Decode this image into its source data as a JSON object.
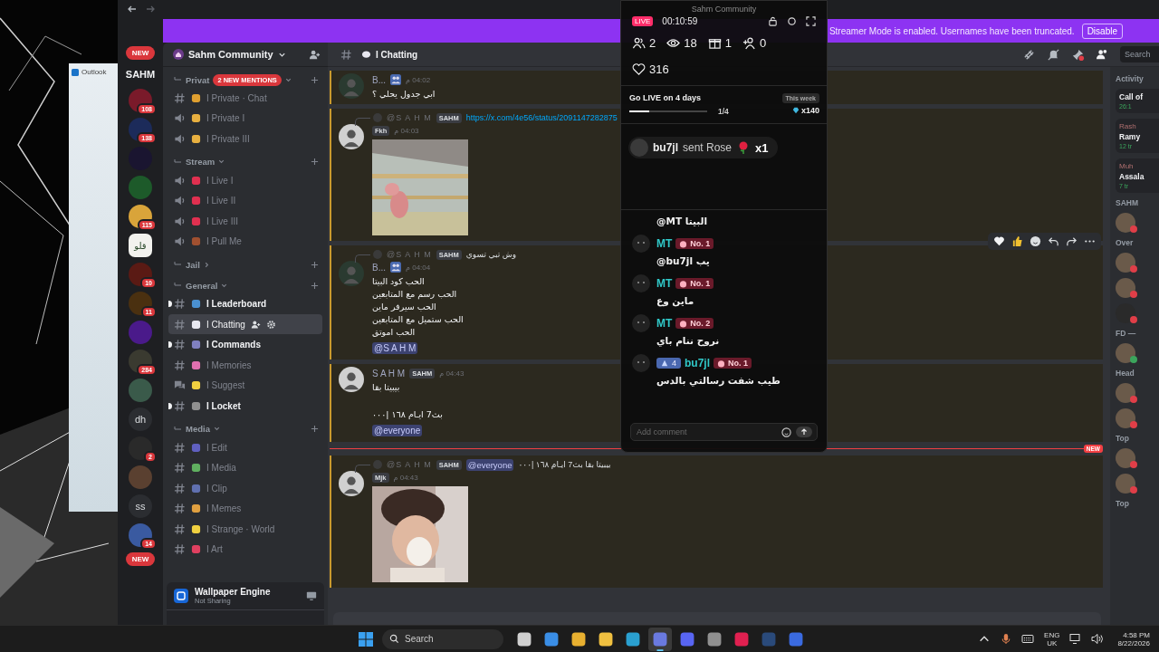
{
  "desktop": {
    "window": {
      "title": "Outlook"
    }
  },
  "discord": {
    "banner": {
      "text": "Streamer Mode is enabled. Usernames have been truncated.",
      "button": "Disable"
    },
    "servers": [
      {
        "kind": "new",
        "label": "NEW"
      },
      {
        "kind": "name",
        "label": "SAHM"
      },
      {
        "kind": "icon",
        "color": "#7a1a2a",
        "badge": "108"
      },
      {
        "kind": "icon",
        "color": "#1c2b5a",
        "badge": "138"
      },
      {
        "kind": "icon",
        "color": "#1a1530"
      },
      {
        "kind": "icon",
        "color": "#1d5a2a"
      },
      {
        "kind": "icon",
        "color": "#d9a43a",
        "badge": "115"
      },
      {
        "kind": "light",
        "label": "قلو"
      },
      {
        "kind": "icon",
        "color": "#5a1a14",
        "badge": "10"
      },
      {
        "kind": "icon",
        "color": "#4a3010",
        "badge": "11"
      },
      {
        "kind": "icon",
        "color": "#4a1a8a"
      },
      {
        "kind": "icon",
        "color": "#3a3a30",
        "badge": "284"
      },
      {
        "kind": "icon",
        "color": "#3a5a4a"
      },
      {
        "kind": "text",
        "label": "dh"
      },
      {
        "kind": "icon",
        "color": "#2a2a2a",
        "badge": "2"
      },
      {
        "kind": "icon",
        "color": "#5a4030"
      },
      {
        "kind": "text",
        "label": "ss"
      },
      {
        "kind": "icon",
        "color": "#3a5aa0",
        "badge": "14"
      },
      {
        "kind": "new",
        "label": "NEW"
      }
    ],
    "server_name": "Sahm Community",
    "categories": [
      {
        "name": "Privat",
        "expanded": true,
        "badge": "2 NEW MENTIONS",
        "channels": [
          {
            "kind": "text",
            "name": "I Private · Chat",
            "color": "#e0a030",
            "unread": false,
            "selected": false
          },
          {
            "kind": "voice",
            "name": "I Private I",
            "color": "#e8b040",
            "unread": false,
            "selected": false
          },
          {
            "kind": "voice",
            "name": "I Private III",
            "color": "#e8b040",
            "unread": false,
            "selected": false
          }
        ]
      },
      {
        "name": "Stream",
        "expanded": true,
        "channels": [
          {
            "kind": "voice",
            "name": "I Live I",
            "color": "#e03050",
            "unread": false,
            "selected": false
          },
          {
            "kind": "voice",
            "name": "I Live II",
            "color": "#e03050",
            "unread": false,
            "selected": false
          },
          {
            "kind": "voice",
            "name": "I Live III",
            "color": "#e03050",
            "unread": false,
            "selected": false
          },
          {
            "kind": "voice",
            "name": "I Pull Me",
            "color": "#a05030",
            "unread": false,
            "selected": false
          }
        ]
      },
      {
        "name": "Jail",
        "expanded": false
      },
      {
        "name": "General",
        "expanded": true,
        "channels": [
          {
            "kind": "text",
            "name": "I Leaderboard",
            "color": "#4a90d0",
            "unread": true,
            "selected": false
          },
          {
            "kind": "text",
            "name": "I Chatting",
            "color": "#e8e8f0",
            "unread": false,
            "selected": true
          },
          {
            "kind": "text",
            "name": "I Commands",
            "color": "#8080c0",
            "unread": true,
            "selected": false
          },
          {
            "kind": "text",
            "name": "I Memories",
            "color": "#e070b0",
            "unread": false,
            "selected": false
          },
          {
            "kind": "forum",
            "name": "I Suggest",
            "color": "#f0d040",
            "unread": false,
            "selected": false
          },
          {
            "kind": "text",
            "name": "I Locket",
            "color": "#909090",
            "unread": true,
            "selected": false
          }
        ]
      },
      {
        "name": "Media",
        "expanded": true,
        "channels": [
          {
            "kind": "text",
            "name": "I Edit",
            "color": "#6060c0",
            "unread": false,
            "selected": false
          },
          {
            "kind": "text",
            "name": "I Media",
            "color": "#60b060",
            "unread": false,
            "selected": false
          },
          {
            "kind": "text",
            "name": "I Clip",
            "color": "#6070b0",
            "unread": false,
            "selected": false
          },
          {
            "kind": "text",
            "name": "I Memes",
            "color": "#e0a040",
            "unread": false,
            "selected": false
          },
          {
            "kind": "text",
            "name": "I Strange · World",
            "color": "#f0d040",
            "unread": false,
            "selected": false
          },
          {
            "kind": "text",
            "name": "I Art",
            "color": "#e04060",
            "unread": false,
            "selected": false
          }
        ]
      }
    ],
    "activity": {
      "title": "Wallpaper Engine",
      "status": "Not Sharing"
    },
    "channel_title": "I Chatting",
    "search": {
      "placeholder": "Search"
    },
    "messages": [
      {
        "kind": "message",
        "author": "B...",
        "time": "04:02 م",
        "paragraphs": [
          [
            "ابي جدول يحلي ؟"
          ]
        ],
        "highlighted": true,
        "toolbar": false
      },
      {
        "kind": "message",
        "reply": {
          "author": "@S A H M",
          "tag": "SAHM",
          "link": "https://x.com/4e56/status/2091147282875"
        },
        "tag": "Fkh",
        "time": "04:03 م",
        "image": true,
        "highlighted": true,
        "toolbar": false
      },
      {
        "kind": "message",
        "reply": {
          "author": "@S A H M",
          "tag": "SAHM",
          "text": "وش تبي تسوي"
        },
        "author": "B...",
        "time": "04:04 م",
        "paragraphs": [
          [
            "الحب كود البيتا",
            "الحب رسم مع المتابعين",
            "الحب سيرفر ماين",
            "الحب ستميل مع المتابعين",
            "الحب اموتق"
          ]
        ],
        "mention": "@S A H M",
        "highlighted": true,
        "toolbar": true
      },
      {
        "kind": "message",
        "author": "S A H M",
        "tag": "SAHM",
        "time": "04:43 م",
        "paragraphs": [
          [
            "بيبيتا بقا"
          ],
          [
            "بث7 ايـام ١٦٨ |٠٠٠"
          ]
        ],
        "mention": "@everyone",
        "highlighted": true,
        "toolbar": false
      },
      {
        "kind": "divider",
        "label": "NEW"
      },
      {
        "kind": "message",
        "reply": {
          "author": "@S A H M",
          "tag": "SAHM",
          "mention": "@everyone",
          "text": "بيبيتا بقا بث7 ايـام ١٦٨ |٠٠٠"
        },
        "tag": "Mjk",
        "time": "04:43 م",
        "image": true,
        "highlighted": true,
        "toolbar": false
      }
    ],
    "members": [
      {
        "kind": "header",
        "text": "Activity"
      },
      {
        "kind": "card",
        "title": "Call of",
        "sub": "26:1"
      },
      {
        "kind": "card",
        "user": "Rash",
        "title": "Ramy",
        "sub": "12 tr"
      },
      {
        "kind": "card",
        "user": "Muh",
        "title": "Assala",
        "sub": "7 tr"
      },
      {
        "kind": "header",
        "text": "SAHM"
      },
      {
        "kind": "member",
        "color": "#e03e48"
      },
      {
        "kind": "header",
        "text": "Over"
      },
      {
        "kind": "member",
        "color": "#e03e48"
      },
      {
        "kind": "member",
        "color": "#e03e48"
      },
      {
        "kind": "member",
        "color": "#e03e48"
      },
      {
        "kind": "header",
        "text": "FD —"
      },
      {
        "kind": "member",
        "color": "#3ba55c"
      },
      {
        "kind": "header",
        "text": "Head"
      },
      {
        "kind": "member",
        "color": "#e03e48"
      },
      {
        "kind": "member",
        "color": "#e03e48"
      },
      {
        "kind": "header",
        "text": "Top"
      },
      {
        "kind": "member",
        "color": "#e03e48"
      },
      {
        "kind": "member",
        "color": "#e03e48"
      },
      {
        "kind": "header",
        "text": "Top"
      }
    ]
  },
  "live_overlay": {
    "title": "Sahm Community",
    "live": "LIVE",
    "timer": "00:10:59",
    "stats": [
      {
        "kind": "people",
        "value": "2"
      },
      {
        "kind": "viewers",
        "value": "18"
      },
      {
        "kind": "gifts",
        "value": "1"
      },
      {
        "kind": "follows",
        "value": "0"
      }
    ],
    "likes": "316",
    "goal": {
      "title": "Go LIVE on 4 days",
      "level": 0.25,
      "progress": "1/4",
      "period": "This week",
      "reward": "x140"
    },
    "gift": {
      "user": "bu7jl",
      "action": "sent Rose",
      "count": "x1"
    },
    "comments": [
      {
        "text": "@MT البيتا"
      },
      {
        "user": "MT",
        "rank": "No. 1",
        "text": "@bu7jl يب"
      },
      {
        "user": "MT",
        "rank": "No. 1",
        "text": "ماين وع"
      },
      {
        "user": "MT",
        "rank": "No. 2",
        "text": "نروح ننام باي"
      },
      {
        "level": "4",
        "user": "bu7jl",
        "rank": "No. 1",
        "text": "طيب شفت رسالتي بالدس"
      }
    ],
    "input": {
      "placeholder": "Add comment"
    }
  },
  "taskbar": {
    "search": "Search",
    "apps": [
      {
        "color": "#d0d0d0",
        "selected": false
      },
      {
        "color": "#3a8ee6",
        "selected": false
      },
      {
        "color": "#e8b030",
        "selected": false
      },
      {
        "color": "#f0c040",
        "selected": false
      },
      {
        "color": "#2aa0d0",
        "selected": false
      },
      {
        "color": "#6a7ae0",
        "selected": true
      },
      {
        "color": "#5865f2",
        "selected": false
      },
      {
        "color": "#909090",
        "selected": false
      },
      {
        "color": "#e02050",
        "selected": false
      },
      {
        "color": "#2a4a7a",
        "selected": false
      },
      {
        "color": "#3a6ae0",
        "selected": false
      }
    ],
    "lang": "ENG",
    "region": "UK",
    "time": "4:58 PM",
    "date": "8/22/2026"
  }
}
